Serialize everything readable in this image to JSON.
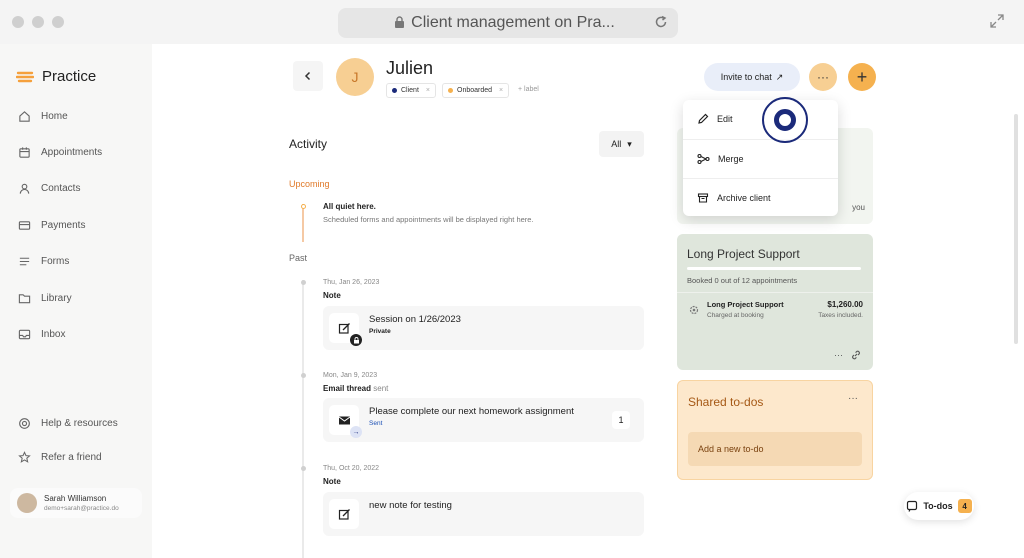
{
  "browser": {
    "url_title": "Client management on Pra..."
  },
  "sidebar": {
    "brand": "Practice",
    "items": [
      {
        "label": "Home",
        "icon": "home-icon"
      },
      {
        "label": "Appointments",
        "icon": "calendar-icon"
      },
      {
        "label": "Contacts",
        "icon": "person-icon"
      },
      {
        "label": "Payments",
        "icon": "card-icon"
      },
      {
        "label": "Forms",
        "icon": "list-icon"
      },
      {
        "label": "Library",
        "icon": "folder-icon"
      },
      {
        "label": "Inbox",
        "icon": "inbox-icon"
      }
    ],
    "bottom_items": [
      {
        "label": "Help & resources",
        "icon": "help-icon"
      },
      {
        "label": "Refer a friend",
        "icon": "star-icon"
      }
    ],
    "user": {
      "name": "Sarah Williamson",
      "email": "demo+sarah@practice.do"
    }
  },
  "header": {
    "avatar_letter": "J",
    "client_name": "Julien",
    "tags": [
      {
        "label": "Client",
        "color": "#1b2a7a"
      },
      {
        "label": "Onboarded",
        "color": "#f5b14f"
      }
    ],
    "add_label": "+ label",
    "invite_label": "Invite to chat",
    "more_label": "···",
    "plus_label": "+"
  },
  "activity": {
    "title": "Activity",
    "filter": "All",
    "upcoming_label": "Upcoming",
    "quiet_title": "All quiet here.",
    "quiet_sub": "Scheduled forms and appointments will be displayed right here.",
    "past_label": "Past",
    "entries": [
      {
        "date": "Thu, Jan 26, 2023",
        "kind": "Note",
        "kind_suffix": "",
        "title": "Session on 1/26/2023",
        "sub": "Private",
        "count": ""
      },
      {
        "date": "Mon, Jan 9, 2023",
        "kind": "Email thread",
        "kind_suffix": "sent",
        "title": "Please complete our next homework assignment",
        "sub": "Sent",
        "count": "1"
      },
      {
        "date": "Thu, Oct 20, 2022",
        "kind": "Note",
        "kind_suffix": "",
        "title": "new note for testing",
        "sub": "",
        "count": ""
      }
    ]
  },
  "menu": {
    "items": [
      {
        "label": "Edit",
        "icon": "pencil-icon"
      },
      {
        "label": "Merge",
        "icon": "merge-icon"
      },
      {
        "label": "Archive client",
        "icon": "archive-icon"
      }
    ]
  },
  "panel_top": {
    "partial_text": "you"
  },
  "package": {
    "title": "Long Project Support",
    "booked": "Booked 0 out of 12 appointments",
    "booked_fraction": 0,
    "item_name": "Long Project Support",
    "item_sub": "Charged at booking",
    "price": "$1,260.00",
    "tax": "Taxes included.",
    "more": "···"
  },
  "todos": {
    "title": "Shared to-dos",
    "more": "···",
    "add": "Add a new to-do",
    "pill_label": "To-dos",
    "pill_count": "4"
  }
}
